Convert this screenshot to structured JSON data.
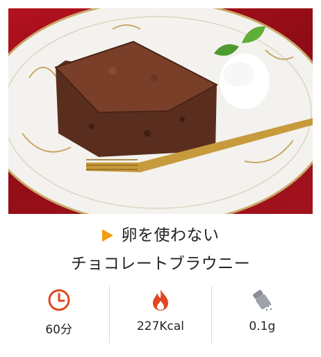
{
  "recipe": {
    "title_line1": "卵を使わない",
    "title_line2": "チョコレートブラウニー",
    "photo_alt": "チョコレートブラウニー"
  },
  "stats": {
    "time": {
      "icon": "clock-icon",
      "value": "60分"
    },
    "calories": {
      "icon": "flame-icon",
      "value": "227Kcal"
    },
    "salt": {
      "icon": "salt-shaker-icon",
      "value": "0.1g"
    }
  },
  "colors": {
    "accent": "#f39c12",
    "icon_red": "#e0461f",
    "divider": "#d9d9d9",
    "background_red": "#a3121e"
  }
}
